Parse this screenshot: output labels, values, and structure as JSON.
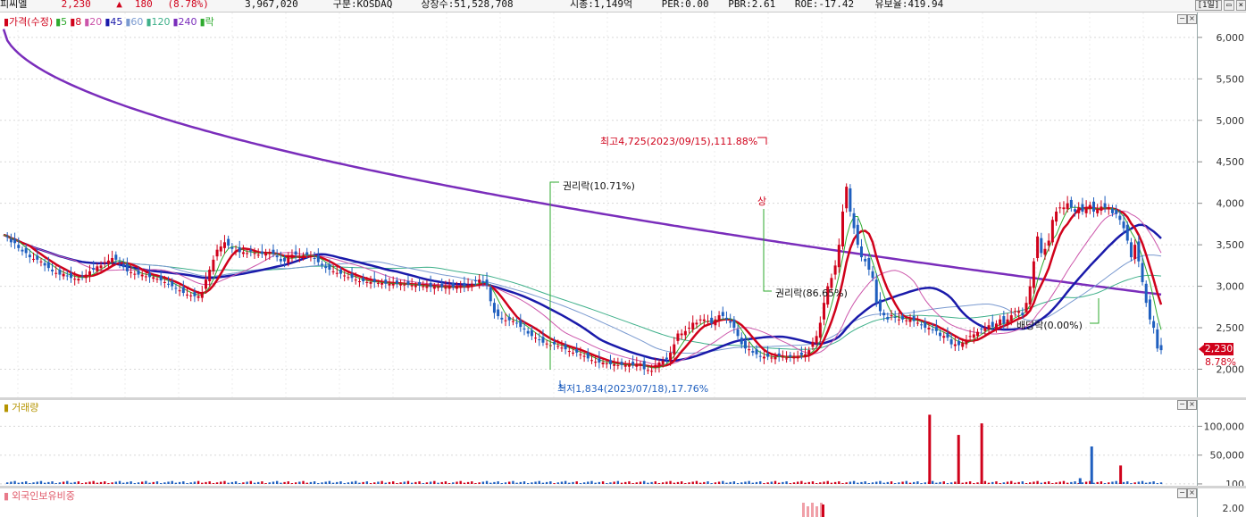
{
  "header": {
    "name": "피씨엘",
    "price": "2,230",
    "change_arrow": "▲",
    "change": "180",
    "change_pct": "(8.78%)",
    "volume": "3,967,020",
    "market": "구분:KOSDAQ",
    "shares": "상장수:51,528,708",
    "mcap": "시총:1,149억",
    "per": "PER:0.00",
    "pbr": "PBR:2.61",
    "roe": "ROE:-17.42",
    "turnover": "유보율:419.94",
    "period_btn": "[1일]",
    "colors": {
      "up": "#d0021b",
      "down": "#1f5fbf"
    }
  },
  "price_panel": {
    "legend": [
      {
        "label": "가격(수정)",
        "color": "#d0021b"
      },
      {
        "label": "5",
        "color": "#2eaa2e"
      },
      {
        "label": "8",
        "color": "#d0021b"
      },
      {
        "label": "20",
        "color": "#cc55aa"
      },
      {
        "label": "45",
        "color": "#1a1aaa"
      },
      {
        "label": "60",
        "color": "#7a9ad0"
      },
      {
        "label": "120",
        "color": "#3fb08a"
      },
      {
        "label": "240",
        "color": "#7a2dbb"
      },
      {
        "label": "락",
        "color": "#2eaa2e"
      }
    ],
    "current_price_label": "2,230",
    "current_change_label": "8.78%",
    "annotations": {
      "high": "최고4,725(2023/09/15),111.88%",
      "low": "최저1,834(2023/07/18),17.76%",
      "rights1": "권리락(10.71%)",
      "rights2": "권리락(86.65%)",
      "dividend": "배당락(0.00%)",
      "upper_limit": "상"
    }
  },
  "volume_panel": {
    "title": "거래량"
  },
  "foreign_panel": {
    "title": "외국인보유비중",
    "tick": "2.00"
  },
  "chart_data": [
    {
      "type": "candlestick",
      "title": "",
      "ylim": [
        1650,
        6300
      ],
      "yticks": [
        6000,
        5500,
        5000,
        4500,
        4000,
        3500,
        3000,
        2500,
        2000
      ],
      "ytick_labels": [
        "6,000",
        "5,500",
        "5,000",
        "4,500",
        "4,000",
        "3,500",
        "3,000",
        "2,500",
        "2,000"
      ],
      "close_series": [
        3620,
        3590,
        3530,
        3520,
        3460,
        3420,
        3400,
        3350,
        3330,
        3320,
        3300,
        3250,
        3220,
        3180,
        3160,
        3140,
        3150,
        3120,
        3100,
        3090,
        3090,
        3120,
        3140,
        3180,
        3200,
        3240,
        3250,
        3290,
        3310,
        3340,
        3320,
        3290,
        3230,
        3180,
        3170,
        3150,
        3140,
        3140,
        3120,
        3110,
        3110,
        3090,
        3070,
        3050,
        3020,
        3000,
        2970,
        2950,
        2920,
        2900,
        2890,
        2880,
        2880,
        2930,
        3080,
        3200,
        3320,
        3440,
        3480,
        3530,
        3490,
        3450,
        3430,
        3410,
        3410,
        3400,
        3420,
        3400,
        3380,
        3390,
        3410,
        3400,
        3390,
        3350,
        3300,
        3300,
        3360,
        3380,
        3380,
        3370,
        3370,
        3380,
        3360,
        3330,
        3290,
        3260,
        3220,
        3200,
        3180,
        3160,
        3150,
        3130,
        3110,
        3100,
        3080,
        3060,
        3060,
        3050,
        3050,
        3050,
        3040,
        3040,
        3030,
        3030,
        3030,
        3030,
        3030,
        3020,
        3020,
        3010,
        3010,
        3010,
        3000,
        3000,
        2990,
        3000,
        2990,
        2990,
        2990,
        3000,
        2990,
        3000,
        3000,
        3000,
        3010,
        3030,
        3060,
        3080,
        3040,
        3010,
        2820,
        2680,
        2640,
        2600,
        2590,
        2590,
        2580,
        2550,
        2510,
        2480,
        2430,
        2400,
        2380,
        2350,
        2320,
        2310,
        2290,
        2300,
        2280,
        2260,
        2240,
        2220,
        2200,
        2200,
        2180,
        2160,
        2130,
        2110,
        2090,
        2080,
        2080,
        2070,
        2060,
        2060,
        2050,
        2050,
        2050,
        2050,
        2050,
        2060,
        2060,
        2000,
        1990,
        1980,
        2050,
        2080,
        2100,
        2120,
        2200,
        2300,
        2430,
        2430,
        2460,
        2500,
        2560,
        2560,
        2600,
        2600,
        2580,
        2550,
        2600,
        2650,
        2640,
        2600,
        2560,
        2500,
        2400,
        2300,
        2250,
        2240,
        2200,
        2180,
        2150,
        2150,
        2150,
        2140,
        2150,
        2160,
        2150,
        2130,
        2150,
        2150,
        2160,
        2170,
        2180,
        2230,
        2330,
        2400,
        2560,
        2800,
        3000,
        3100,
        3250,
        3500,
        3900,
        4200,
        3900,
        3700,
        3500,
        3350,
        3300,
        3200,
        3100,
        2800,
        2700,
        2650,
        2600,
        2650,
        2620,
        2600,
        2600,
        2590,
        2600,
        2580,
        2560,
        2530,
        2500,
        2500,
        2470,
        2460,
        2400,
        2400,
        2380,
        2300,
        2300,
        2290,
        2320,
        2350,
        2400,
        2420,
        2450,
        2480,
        2500,
        2530,
        2510,
        2550,
        2600,
        2550,
        2600,
        2650,
        2700,
        2700,
        2650,
        2800,
        3000,
        3300,
        3600,
        3400,
        3450,
        3550,
        3800,
        3900,
        3950,
        3950,
        4000,
        3950,
        3900,
        3950,
        3900,
        3950,
        3980,
        3900,
        3930,
        3960,
        3950,
        3950,
        3880,
        3870,
        3800,
        3700,
        3550,
        3350,
        3500,
        3300,
        3050,
        2800,
        2600,
        2500,
        2250,
        2230
      ]
    },
    {
      "type": "bar",
      "title": "",
      "ylabel": "",
      "yticks": [
        100000,
        50000,
        100
      ],
      "ytick_labels": [
        "100,000",
        "50,000",
        "100"
      ],
      "highlights": [
        {
          "position": 0.8,
          "value": 120000,
          "color": "up"
        },
        {
          "position": 0.825,
          "value": 85000,
          "color": "up"
        },
        {
          "position": 0.845,
          "value": 105000,
          "color": "up"
        },
        {
          "position": 0.93,
          "value": 10000,
          "color": "down"
        },
        {
          "position": 0.94,
          "value": 65000,
          "color": "down"
        },
        {
          "position": 0.965,
          "value": 32000,
          "color": "up"
        }
      ]
    }
  ]
}
